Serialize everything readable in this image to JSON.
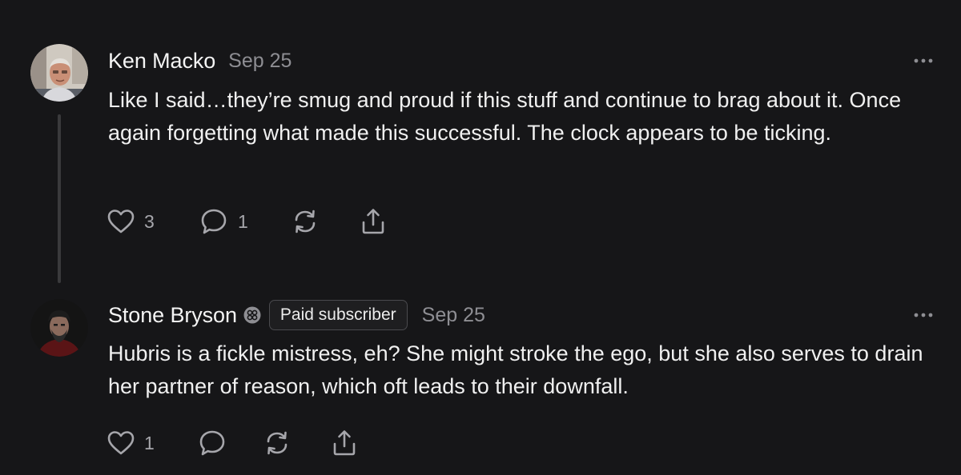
{
  "comments": [
    {
      "author": "Ken Macko",
      "date": "Sep 25",
      "text": "Like I said…they’re smug and proud if this stuff and continue to brag about it. Once again forgetting what made this successful. The clock appears to be ticking.",
      "likes": "3",
      "replies": "1"
    },
    {
      "author": "Stone Bryson",
      "badge": "Paid subscriber",
      "date": "Sep 25",
      "text": "Hubris is a fickle mistress, eh? She might stroke the ego, but she also serves to drain her partner of reason, which oft leads to their downfall.",
      "likes": "1",
      "replies": ""
    }
  ],
  "icons": {
    "like": "heart-icon",
    "reply": "speech-bubble-icon",
    "restack": "restack-icon",
    "share": "share-icon",
    "more": "ellipsis-icon",
    "supporter": "founding-supporter-icon"
  },
  "colors": {
    "background": "#161618",
    "text": "#f0f0f0",
    "muted": "#8e8e93"
  }
}
